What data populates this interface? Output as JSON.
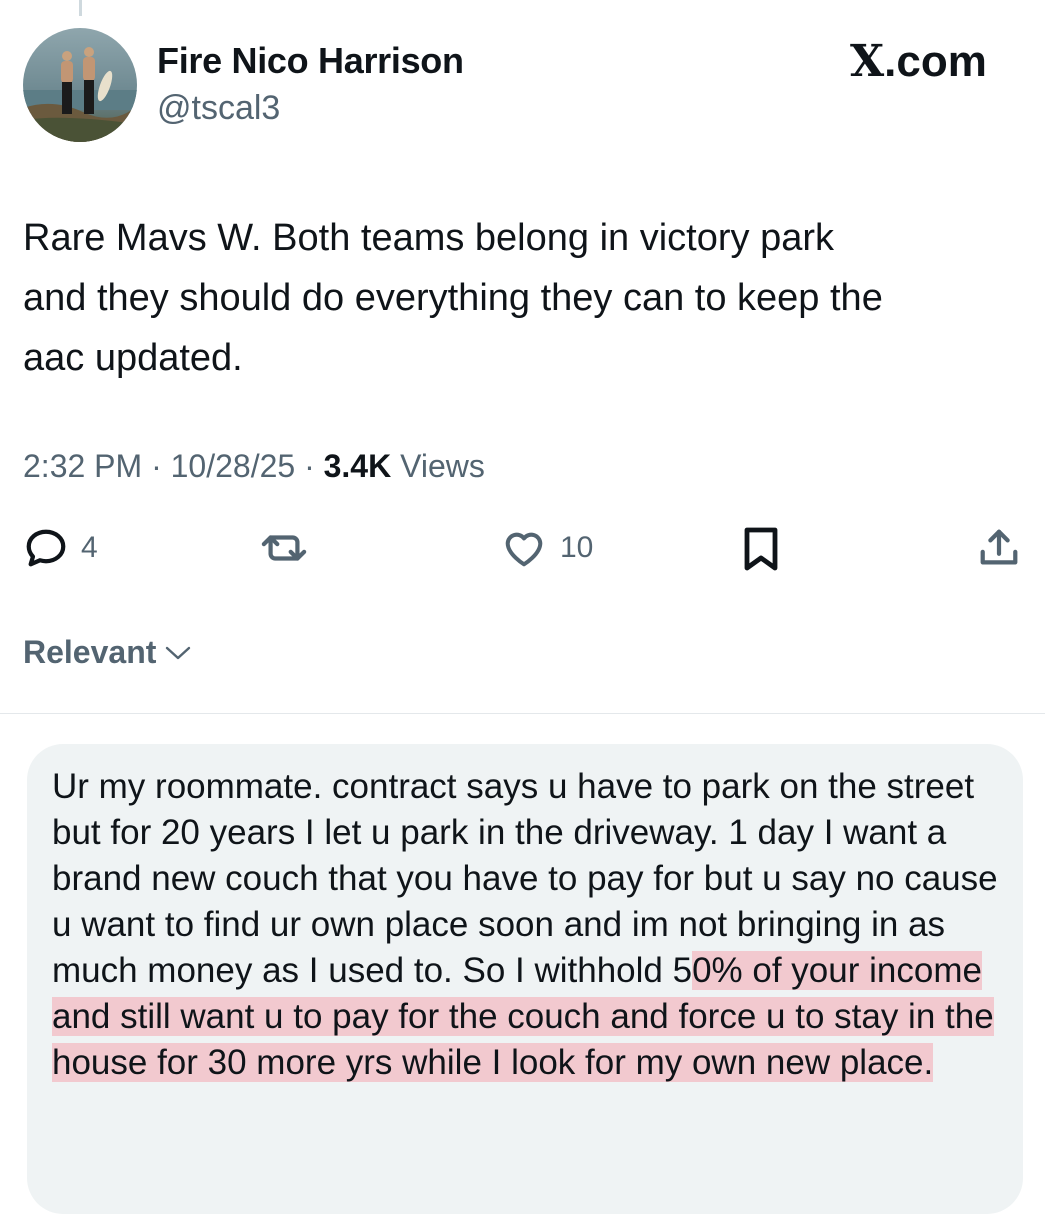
{
  "author": {
    "display_name": "Fire Nico Harrison",
    "handle": "@tscal3"
  },
  "brand_label": "X.com",
  "tweet": {
    "text": "Rare Mavs W. Both teams belong in victory park\nand they should do everything they can to keep the\naac updated.",
    "time": "2:32 PM",
    "date": "10/28/25",
    "separator": "·",
    "views_count": "3.4K",
    "views_label": "Views"
  },
  "actions": {
    "reply_count": "4",
    "like_count": "10"
  },
  "sort_label": "Relevant",
  "reply": {
    "text_plain": "Ur my roommate. contract says u have to park on the street but for 20 years I let u park in the driveway. 1 day I want a brand new couch that you have to pay for but u say no cause u want to find ur own place soon and im not bringing in as much money as I used to. So I withhold 5",
    "text_highlighted": "0% of your income and still want u to pay for the couch and force u to stay in the house for 30 more yrs while I look for my own new place."
  },
  "icons": {
    "reply": "reply-icon",
    "repost": "repost-icon",
    "like": "heart-icon",
    "bookmark": "bookmark-icon",
    "share": "share-icon",
    "sort": "chevron-down-icon"
  },
  "colors": {
    "text_primary": "#0f1419",
    "text_secondary": "#536471",
    "card_background": "#eff3f4",
    "highlight": "#f2c9cf"
  }
}
